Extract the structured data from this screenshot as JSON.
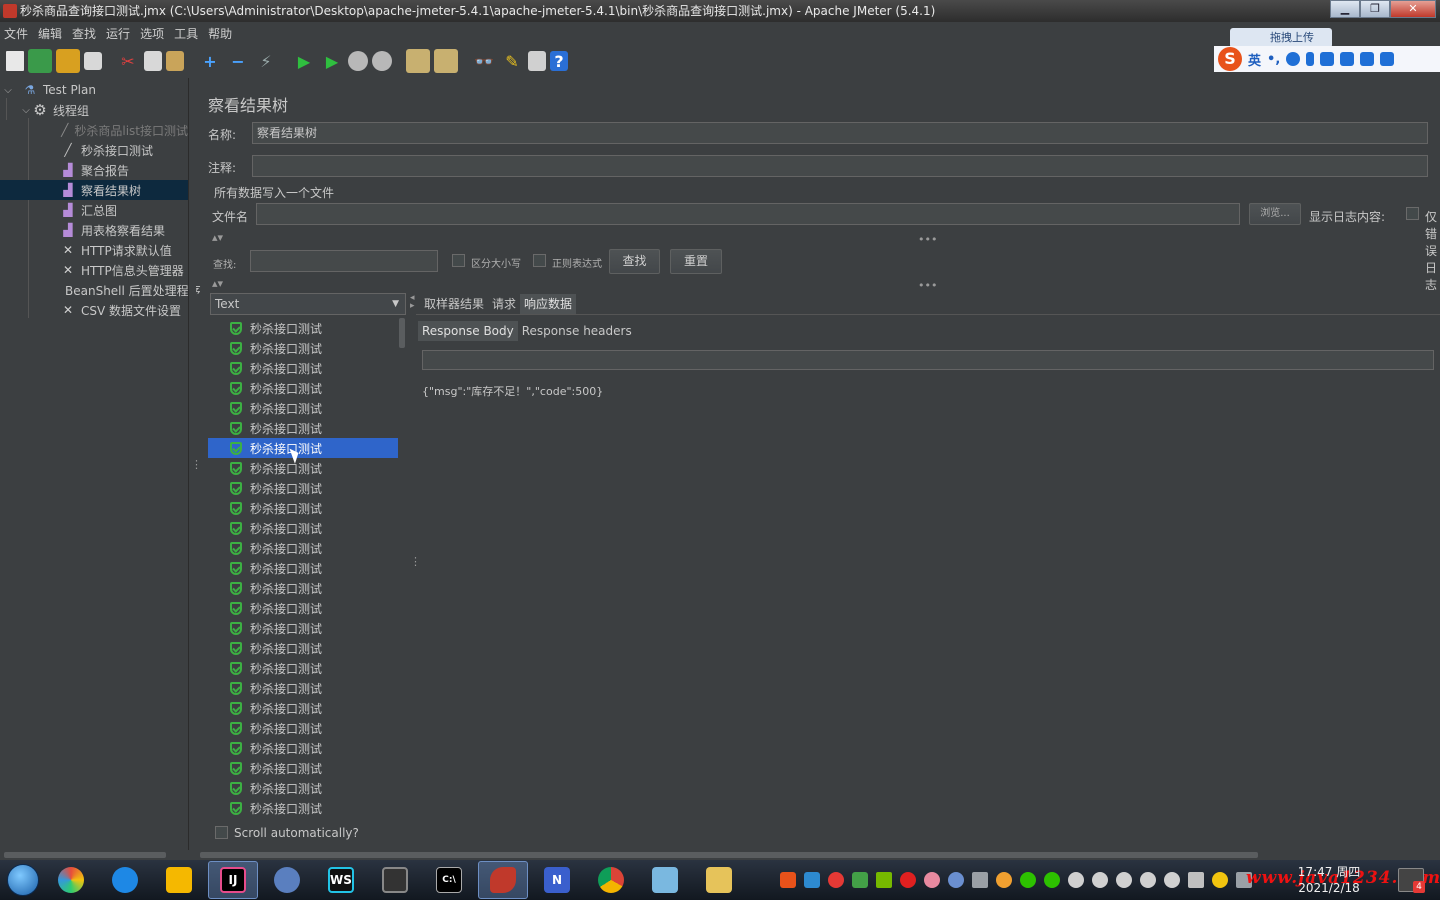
{
  "window": {
    "title": "秒杀商品查询接口测试.jmx (C:\\Users\\Administrator\\Desktop\\apache-jmeter-5.4.1\\apache-jmeter-5.4.1\\bin\\秒杀商品查询接口测试.jmx) - Apache JMeter (5.4.1)",
    "minimize": "▁",
    "maximize": "❐",
    "close": "✕"
  },
  "menu": [
    "文件",
    "编辑",
    "查找",
    "运行",
    "选项",
    "工具",
    "帮助"
  ],
  "ime": {
    "upload_label": "拖拽上传",
    "logo": "S",
    "lang": "英",
    "punct": "•,"
  },
  "tree": {
    "items": [
      {
        "label": "Test Plan",
        "icon": "flask-icon"
      },
      {
        "label": "线程组",
        "icon": "gear-icon"
      },
      {
        "label": "秒杀商品list接口测试",
        "icon": "pen-icon"
      },
      {
        "label": "秒杀接口测试",
        "icon": "pen-icon"
      },
      {
        "label": "聚合报告",
        "icon": "chart-icon"
      },
      {
        "label": "察看结果树",
        "icon": "chart-icon"
      },
      {
        "label": "汇总图",
        "icon": "chart-icon"
      },
      {
        "label": "用表格察看结果",
        "icon": "chart-icon"
      },
      {
        "label": "HTTP请求默认值",
        "icon": "tools-icon"
      },
      {
        "label": "HTTP信息头管理器",
        "icon": "tools-icon"
      },
      {
        "label": "BeanShell 后置处理程序",
        "icon": "script-icon"
      },
      {
        "label": "CSV 数据文件设置",
        "icon": "tools-icon"
      }
    ]
  },
  "panel": {
    "heading": "察看结果树",
    "name_label": "名称:",
    "name_value": "察看结果树",
    "comment_label": "注释:",
    "comment_value": "",
    "write_all_label": "所有数据写入一个文件",
    "filename_label": "文件名",
    "filename_value": "",
    "browse_label": "浏览...",
    "log_content_label": "显示日志内容:",
    "errors_only_label": "仅错误日志"
  },
  "search": {
    "label": "查找:",
    "value": "",
    "case_label": "区分大小写",
    "regex_label": "正则表达式",
    "find_button": "查找",
    "reset_button": "重置"
  },
  "renderer": {
    "selected": "Text",
    "arrow": "▼"
  },
  "results": {
    "item_label": "秒杀接口测试",
    "count": 25,
    "selected_index": 6,
    "scroll_auto_label": "Scroll automatically?"
  },
  "result_tabs": [
    "取样器结果",
    "请求",
    "响应数据"
  ],
  "result_tabs_active": 2,
  "response_tabs": [
    "Response Body",
    "Response headers"
  ],
  "response_tabs_active": 0,
  "response_body": "{\"msg\":\"库存不足！\",\"code\":500}",
  "taskbar": {
    "time": "17:47 周四",
    "date": "2021/2/18",
    "watermark": "www.java1234.com",
    "badge": "4"
  }
}
